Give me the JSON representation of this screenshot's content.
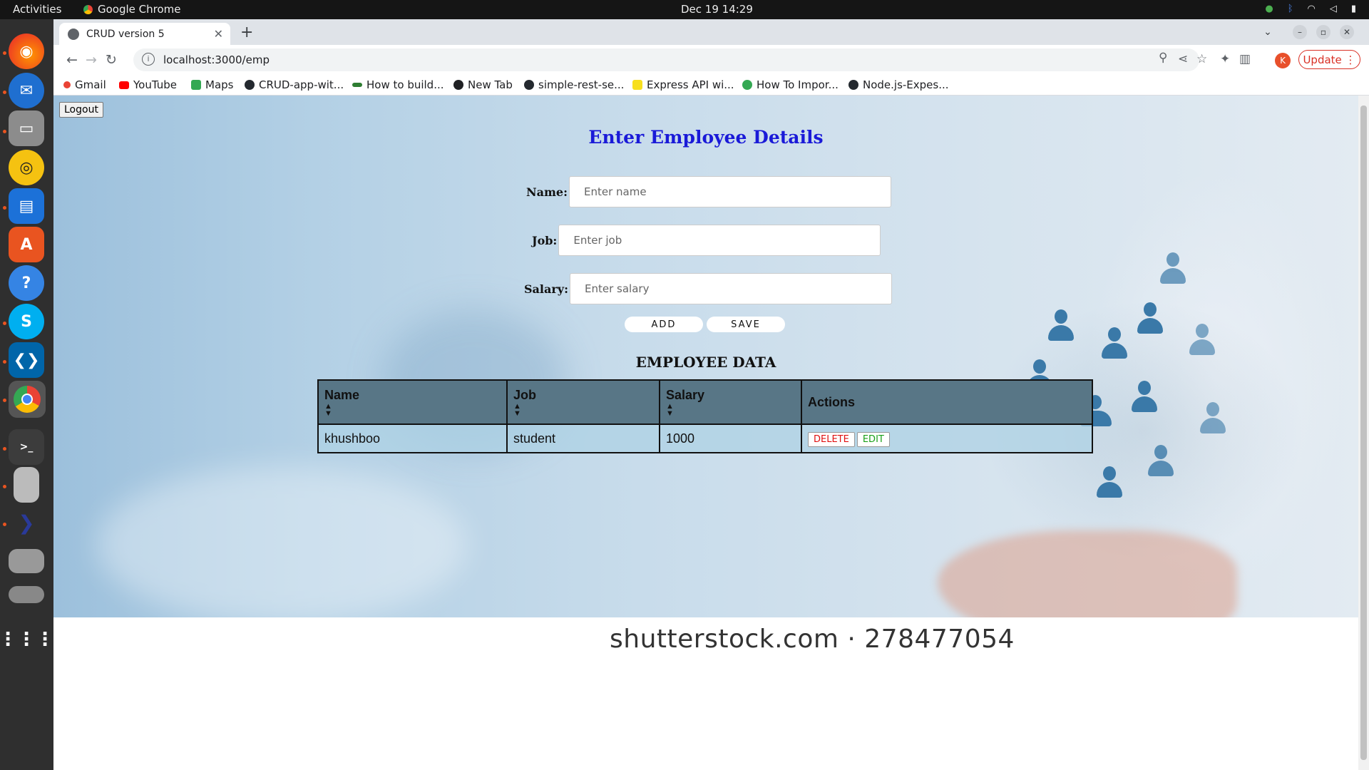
{
  "topbar": {
    "activities": "Activities",
    "app_name": "Google Chrome",
    "clock": "Dec 19  14:29"
  },
  "dock": {
    "items": [
      "firefox-icon",
      "thunderbird-icon",
      "files-icon",
      "rhythmbox-icon",
      "writer-icon",
      "app-center-icon",
      "help-icon",
      "skype-icon",
      "vscode-icon",
      "chrome-icon",
      "terminal-icon",
      "usb-icon",
      "app-icon",
      "disk-icon",
      "drive-icon",
      "apps-grid-icon"
    ]
  },
  "browser": {
    "tab_title": "CRUD version 5",
    "url": "localhost:3000/emp",
    "avatar_letter": "K",
    "update_label": "Update",
    "bookmarks": [
      {
        "label": "Gmail",
        "color": "#ea4335"
      },
      {
        "label": "YouTube",
        "color": "#ff0000"
      },
      {
        "label": "Maps",
        "color": "#34a853"
      },
      {
        "label": "CRUD-app-wit...",
        "color": "#24292f"
      },
      {
        "label": "How to build...",
        "color": "#2e7d32"
      },
      {
        "label": "New Tab",
        "color": "#202124"
      },
      {
        "label": "simple-rest-se...",
        "color": "#24292f"
      },
      {
        "label": "Express API wi...",
        "color": "#f7df1e"
      },
      {
        "label": "How To Impor...",
        "color": "#34a853"
      },
      {
        "label": "Node.js-Expes...",
        "color": "#24292f"
      }
    ]
  },
  "page": {
    "logout_label": "Logout",
    "form_title": "Enter Employee Details",
    "name_label": "Name:",
    "name_placeholder": "Enter name",
    "job_label": "Job:",
    "job_placeholder": "Enter job",
    "salary_label": "Salary:",
    "salary_placeholder": "Enter salary",
    "add_label": "ADD",
    "save_label": "SAVE",
    "table_title": "EMPLOYEE DATA",
    "columns": [
      "Name",
      "Job",
      "Salary",
      "Actions"
    ],
    "rows": [
      {
        "name": "khushboo",
        "job": "student",
        "salary": "1000"
      }
    ],
    "delete_label": "DELETE",
    "edit_label": "EDIT",
    "watermark": "shutterstock.com · 278477054"
  },
  "colors": {
    "title_blue": "#1a1ad8",
    "header_bg": "#587686",
    "delete_red": "#e01010",
    "edit_green": "#18a018"
  }
}
